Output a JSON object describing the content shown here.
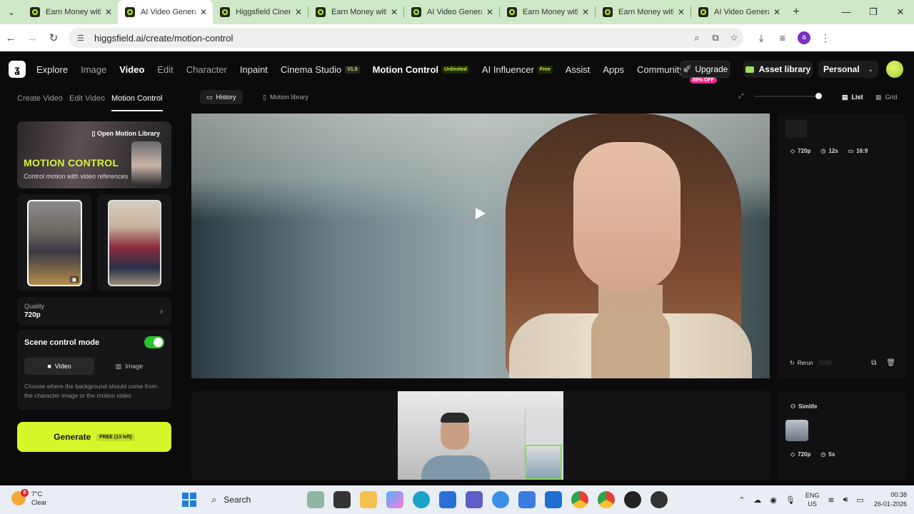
{
  "browser": {
    "tabs": [
      {
        "title": "Earn Money with",
        "active": false
      },
      {
        "title": "AI Video Genera",
        "active": true
      },
      {
        "title": "Higgsfield Cinen",
        "active": false
      },
      {
        "title": "Earn Money with",
        "active": false
      },
      {
        "title": "AI Video Genera",
        "active": false
      },
      {
        "title": "Earn Money with",
        "active": false
      },
      {
        "title": "Earn Money with",
        "active": false
      },
      {
        "title": "AI Video Genera",
        "active": false
      }
    ],
    "url": "higgsfield.ai/create/motion-control",
    "profile_initial": "a"
  },
  "header": {
    "nav": [
      "Explore",
      "Image",
      "Video",
      "Edit",
      "Character",
      "Inpaint",
      "Cinema Studio",
      "Motion Control",
      "AI Influencer",
      "Assist",
      "Apps",
      "Community"
    ],
    "cinema_badge": "V1.5",
    "motion_badge": "Unlimited",
    "influencer_badge": "Free",
    "upgrade": "Upgrade",
    "upgrade_off": "85% OFF",
    "asset_library": "Asset library",
    "personal": "Personal"
  },
  "left": {
    "subtabs": [
      "Create Video",
      "Edit Video",
      "Motion Control"
    ],
    "banner": {
      "open_library": "Open Motion Library",
      "title": "MOTION CONTROL",
      "subtitle": "Control motion with video references"
    },
    "quality_label": "Quality",
    "quality_value": "720p",
    "scene_label": "Scene control mode",
    "scene_toggle_on": true,
    "scene_options": [
      "Video",
      "Image"
    ],
    "scene_desc": "Choose where the background should come from: the character image or the motion video",
    "generate": "Generate",
    "generate_free": "FREE (13 left)"
  },
  "main": {
    "tabs": [
      "History",
      "Motion library"
    ],
    "views": [
      "List",
      "Grid"
    ],
    "item1": {
      "res": "720p",
      "dur": "12s",
      "ratio": "16:9",
      "rerun": "Rerun",
      "date": "2026"
    },
    "item2": {
      "title": "Simlife",
      "res": "720p",
      "dur": "5s"
    }
  },
  "taskbar": {
    "temp": "7°C",
    "cond": "Clear",
    "weather_badge": "8",
    "search": "Search",
    "lang1": "ENG",
    "lang2": "US",
    "time": "00:38",
    "date": "26-01-2026"
  }
}
